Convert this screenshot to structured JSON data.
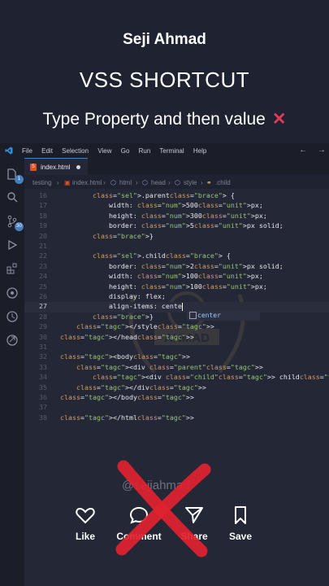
{
  "header": {
    "author": "Seji Ahmad",
    "title": "VSS SHORTCUT",
    "subtitle": "Type Property and then value",
    "subtitle_mark": "✕"
  },
  "menubar": {
    "items": [
      "File",
      "Edit",
      "Selection",
      "View",
      "Go",
      "Run",
      "Terminal",
      "Help"
    ],
    "back": "←",
    "forward": "→"
  },
  "activity": {
    "explorer_badge": "1",
    "scm_badge": "30"
  },
  "tab": {
    "name": "index.html"
  },
  "breadcrumb": [
    "testing",
    "›",
    "index.html",
    "›",
    "html",
    "›",
    "head",
    "›",
    "style",
    "›",
    ".child"
  ],
  "editor": {
    "suggestion": "center",
    "lines": [
      {
        "n": "16",
        "code": "        .parent {"
      },
      {
        "n": "17",
        "code": "            width: 500px;"
      },
      {
        "n": "18",
        "code": "            height: 300px;"
      },
      {
        "n": "19",
        "code": "            border: 5px solid;"
      },
      {
        "n": "20",
        "code": "        }"
      },
      {
        "n": "21",
        "code": ""
      },
      {
        "n": "22",
        "code": "        .child {"
      },
      {
        "n": "23",
        "code": "            border: 2px solid;"
      },
      {
        "n": "24",
        "code": "            width: 100px;"
      },
      {
        "n": "25",
        "code": "            height: 100px;"
      },
      {
        "n": "26",
        "code": "            display: flex;"
      },
      {
        "n": "27",
        "code": "            align-items: cente"
      },
      {
        "n": "28",
        "code": "        }"
      },
      {
        "n": "29",
        "code": "    </style>"
      },
      {
        "n": "30",
        "code": "</head>"
      },
      {
        "n": "31",
        "code": ""
      },
      {
        "n": "32",
        "code": "<body>"
      },
      {
        "n": "33",
        "code": "    <div class=\"parent\">"
      },
      {
        "n": "34",
        "code": "        <div class=\"child\"> child</div>"
      },
      {
        "n": "35",
        "code": "    </div>"
      },
      {
        "n": "36",
        "code": "</body>"
      },
      {
        "n": "37",
        "code": ""
      },
      {
        "n": "38",
        "code": "</html>"
      }
    ]
  },
  "watermark": {
    "handle": "@sejiahmad",
    "emblem_text": "AHMAD"
  },
  "actions": {
    "like": "Like",
    "comment": "Comment",
    "share": "Share",
    "save": "Save"
  },
  "colors": {
    "accent": "#4a7ebd",
    "cross": "#e03a5a",
    "big_cross": "#e0222f"
  }
}
